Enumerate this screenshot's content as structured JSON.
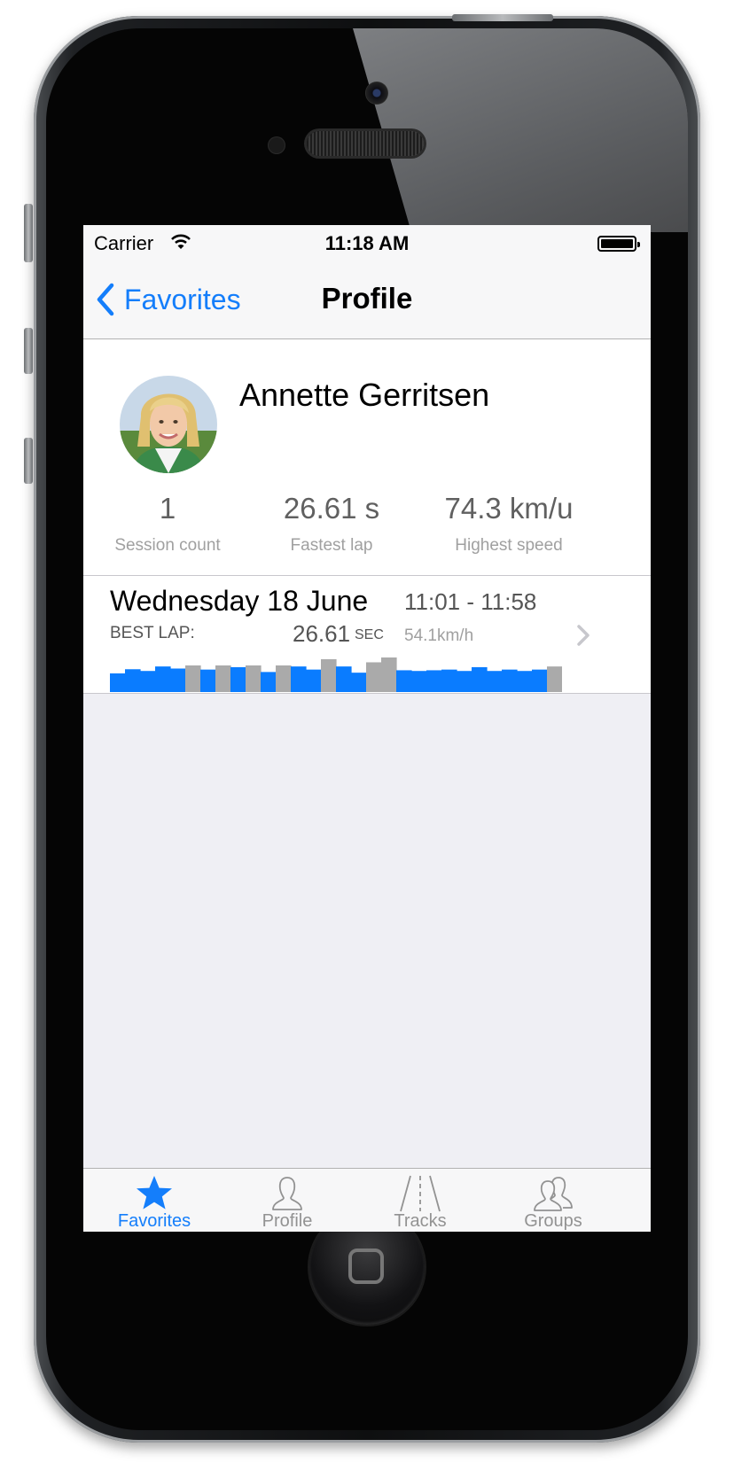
{
  "status_bar": {
    "carrier": "Carrier",
    "time": "11:18 AM"
  },
  "nav": {
    "back_label": "Favorites",
    "title": "Profile"
  },
  "profile": {
    "name": "Annette Gerritsen",
    "stats": [
      {
        "value": "1",
        "label": "Session count"
      },
      {
        "value": "26.61 s",
        "label": "Fastest lap"
      },
      {
        "value": "74.3 km/u",
        "label": "Highest speed"
      }
    ]
  },
  "session": {
    "date": "Wednesday 18 June",
    "time_range": "11:01 - 11:58",
    "best_lap_label": "BEST LAP:",
    "best_lap_value": "26.61",
    "best_lap_unit": "SEC",
    "speed": "54.1km/h",
    "lap_bars": [
      {
        "h": 0.54,
        "c": "blue"
      },
      {
        "h": 0.66,
        "c": "blue"
      },
      {
        "h": 0.61,
        "c": "blue"
      },
      {
        "h": 0.74,
        "c": "blue"
      },
      {
        "h": 0.68,
        "c": "blue"
      },
      {
        "h": 0.77,
        "c": "gray"
      },
      {
        "h": 0.65,
        "c": "blue"
      },
      {
        "h": 0.77,
        "c": "gray"
      },
      {
        "h": 0.72,
        "c": "blue"
      },
      {
        "h": 0.77,
        "c": "gray"
      },
      {
        "h": 0.58,
        "c": "blue"
      },
      {
        "h": 0.77,
        "c": "gray"
      },
      {
        "h": 0.74,
        "c": "blue"
      },
      {
        "h": 0.65,
        "c": "blue"
      },
      {
        "h": 0.95,
        "c": "gray"
      },
      {
        "h": 0.74,
        "c": "blue"
      },
      {
        "h": 0.56,
        "c": "blue"
      },
      {
        "h": 0.86,
        "c": "gray"
      },
      {
        "h": 1.0,
        "c": "gray"
      },
      {
        "h": 0.63,
        "c": "blue"
      },
      {
        "h": 0.61,
        "c": "blue"
      },
      {
        "h": 0.63,
        "c": "blue"
      },
      {
        "h": 0.65,
        "c": "blue"
      },
      {
        "h": 0.61,
        "c": "blue"
      },
      {
        "h": 0.72,
        "c": "blue"
      },
      {
        "h": 0.61,
        "c": "blue"
      },
      {
        "h": 0.65,
        "c": "blue"
      },
      {
        "h": 0.61,
        "c": "blue"
      },
      {
        "h": 0.65,
        "c": "blue"
      },
      {
        "h": 0.74,
        "c": "gray"
      }
    ]
  },
  "tabs": [
    {
      "label": "Favorites",
      "icon": "star-icon",
      "active": true
    },
    {
      "label": "Profile",
      "icon": "person-icon",
      "active": false
    },
    {
      "label": "Tracks",
      "icon": "road-icon",
      "active": false
    },
    {
      "label": "Groups",
      "icon": "group-icon",
      "active": false
    }
  ],
  "colors": {
    "accent": "#147efb",
    "bar_blue": "#0a7cff",
    "bar_gray": "#aaaaaa",
    "tab_inactive": "#929292"
  }
}
